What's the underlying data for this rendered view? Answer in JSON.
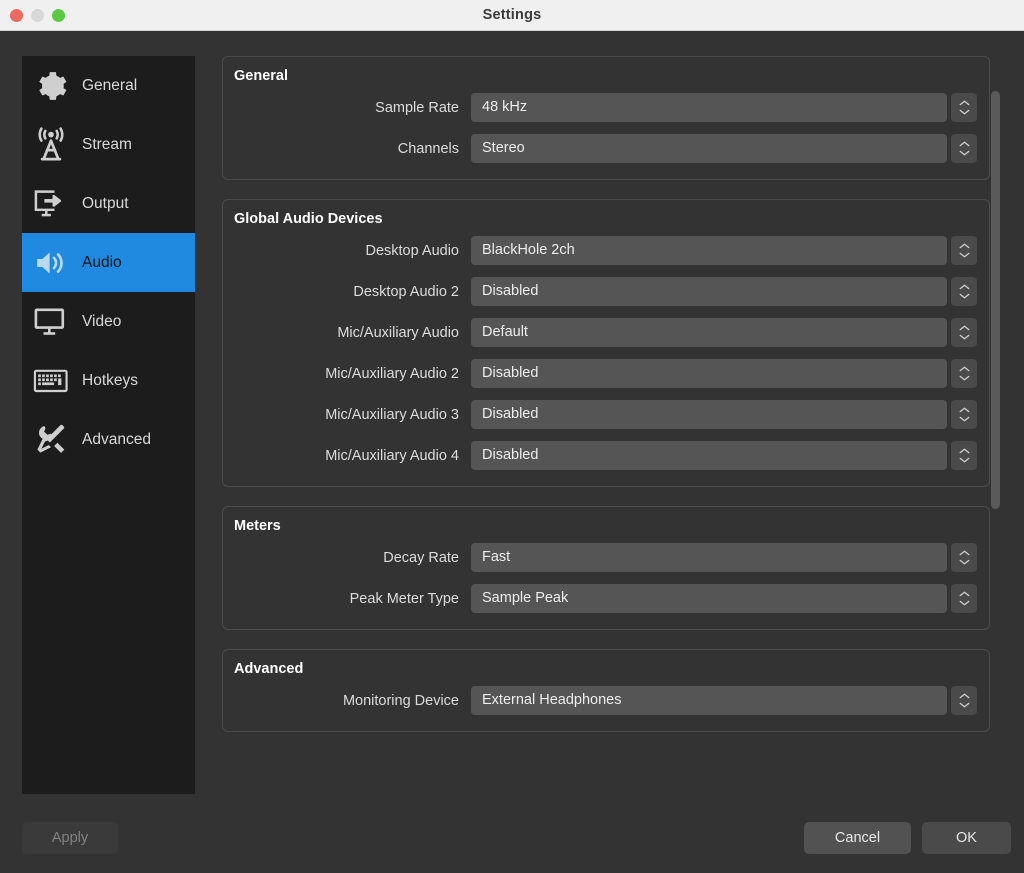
{
  "window": {
    "title": "Settings",
    "traffic_lights": [
      "close",
      "minimize",
      "maximize"
    ],
    "accent_color": "#1f8ae0"
  },
  "sidebar": {
    "items": [
      {
        "label": "General",
        "icon": "gear-icon",
        "selected": false
      },
      {
        "label": "Stream",
        "icon": "broadcast-icon",
        "selected": false
      },
      {
        "label": "Output",
        "icon": "monitor-arrow-icon",
        "selected": false
      },
      {
        "label": "Audio",
        "icon": "speaker-icon",
        "selected": true
      },
      {
        "label": "Video",
        "icon": "display-icon",
        "selected": false
      },
      {
        "label": "Hotkeys",
        "icon": "keyboard-icon",
        "selected": false
      },
      {
        "label": "Advanced",
        "icon": "tools-icon",
        "selected": false
      }
    ]
  },
  "content": {
    "groups": [
      {
        "title": "General",
        "rows": [
          {
            "label": "Sample Rate",
            "value": "48 kHz"
          },
          {
            "label": "Channels",
            "value": "Stereo"
          }
        ]
      },
      {
        "title": "Global Audio Devices",
        "rows": [
          {
            "label": "Desktop Audio",
            "value": "BlackHole 2ch"
          },
          {
            "label": "Desktop Audio 2",
            "value": "Disabled"
          },
          {
            "label": "Mic/Auxiliary Audio",
            "value": "Default"
          },
          {
            "label": "Mic/Auxiliary Audio 2",
            "value": "Disabled"
          },
          {
            "label": "Mic/Auxiliary Audio 3",
            "value": "Disabled"
          },
          {
            "label": "Mic/Auxiliary Audio 4",
            "value": "Disabled"
          }
        ]
      },
      {
        "title": "Meters",
        "rows": [
          {
            "label": "Decay Rate",
            "value": "Fast"
          },
          {
            "label": "Peak Meter Type",
            "value": "Sample Peak"
          }
        ]
      },
      {
        "title": "Advanced",
        "rows": [
          {
            "label": "Monitoring Device",
            "value": "External Headphones"
          }
        ]
      }
    ]
  },
  "footer": {
    "apply_label": "Apply",
    "apply_enabled": false,
    "cancel_label": "Cancel",
    "ok_label": "OK"
  }
}
